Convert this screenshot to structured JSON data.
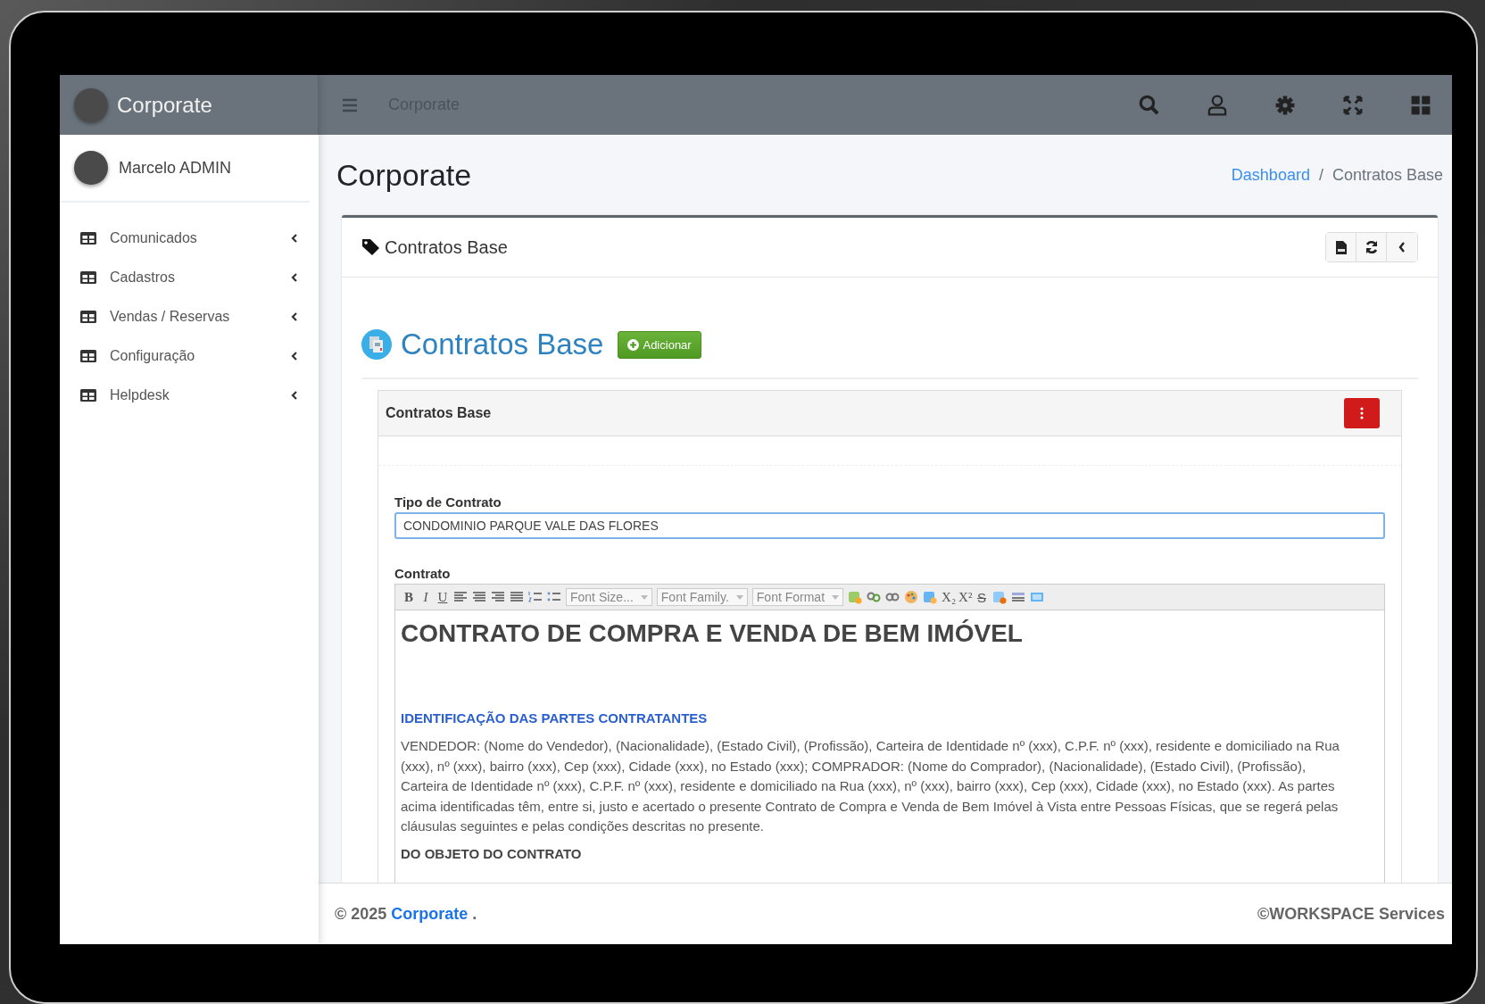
{
  "sidebar": {
    "brand": "Corporate",
    "user": "Marcelo ADMIN",
    "items": [
      {
        "label": "Comunicados",
        "expanded": false
      },
      {
        "label": "Cadastros",
        "expanded": false
      },
      {
        "label": "Vendas / Reservas",
        "expanded": false
      },
      {
        "label": "Configuração",
        "expanded": false
      },
      {
        "label": "Helpdesk",
        "expanded": false
      }
    ]
  },
  "topbar": {
    "title": "Corporate"
  },
  "page": {
    "title": "Corporate",
    "breadcrumb_separator": "/",
    "breadcrumb": [
      {
        "label": "Dashboard",
        "kind": "link"
      },
      {
        "label": "Contratos Base",
        "kind": "current"
      }
    ]
  },
  "card": {
    "title": "Contratos Base",
    "heading": "Contratos Base",
    "add_button": "Adicionar",
    "panel": {
      "title": "Contratos Base",
      "fields": [
        {
          "label": "Tipo de Contrato",
          "value": "CONDOMINIO PARQUE VALE DAS FLORES"
        }
      ],
      "editor": {
        "label": "Contrato",
        "toolbar": {
          "format_buttons": [
            "B",
            "I",
            "U"
          ],
          "selects": [
            "Font Size...",
            "Font Family.",
            "Font Format"
          ],
          "subscript": "X₂",
          "superscript": "X²",
          "strike": "S"
        },
        "content": [
          {
            "kind": "title",
            "text": "CONTRATO DE COMPRA E VENDA DE BEM IMÓVEL"
          },
          {
            "kind": "heading",
            "text": "IDENTIFICAÇÃO DAS PARTES CONTRATANTES"
          },
          {
            "kind": "paragraph",
            "text": "VENDEDOR: (Nome do Vendedor), (Nacionalidade), (Estado Civil), (Profissão), Carteira de Identidade nº (xxx), C.P.F. nº (xxx), residente e domiciliado na Rua (xxx), nº (xxx), bairro (xxx), Cep (xxx), Cidade (xxx), no Estado (xxx); COMPRADOR: (Nome do Comprador), (Nacionalidade), (Estado Civil), (Profissão), Carteira de Identidade nº (xxx), C.P.F. nº (xxx), residente e domiciliado na Rua (xxx), nº (xxx), bairro (xxx), Cep (xxx), Cidade (xxx), no Estado (xxx). As partes acima identificadas têm, entre si, justo e acertado o presente Contrato de Compra e Venda de Bem Imóvel à Vista entre Pessoas Físicas, que se regerá pelas cláusulas seguintes e pelas condições descritas no presente."
          },
          {
            "kind": "subheading",
            "text": "DO OBJETO DO CONTRATO"
          }
        ]
      }
    }
  },
  "footer": {
    "year": "© 2025",
    "brand": "Corporate",
    "dot": ".",
    "credit": "©WORKSPACE Services"
  }
}
